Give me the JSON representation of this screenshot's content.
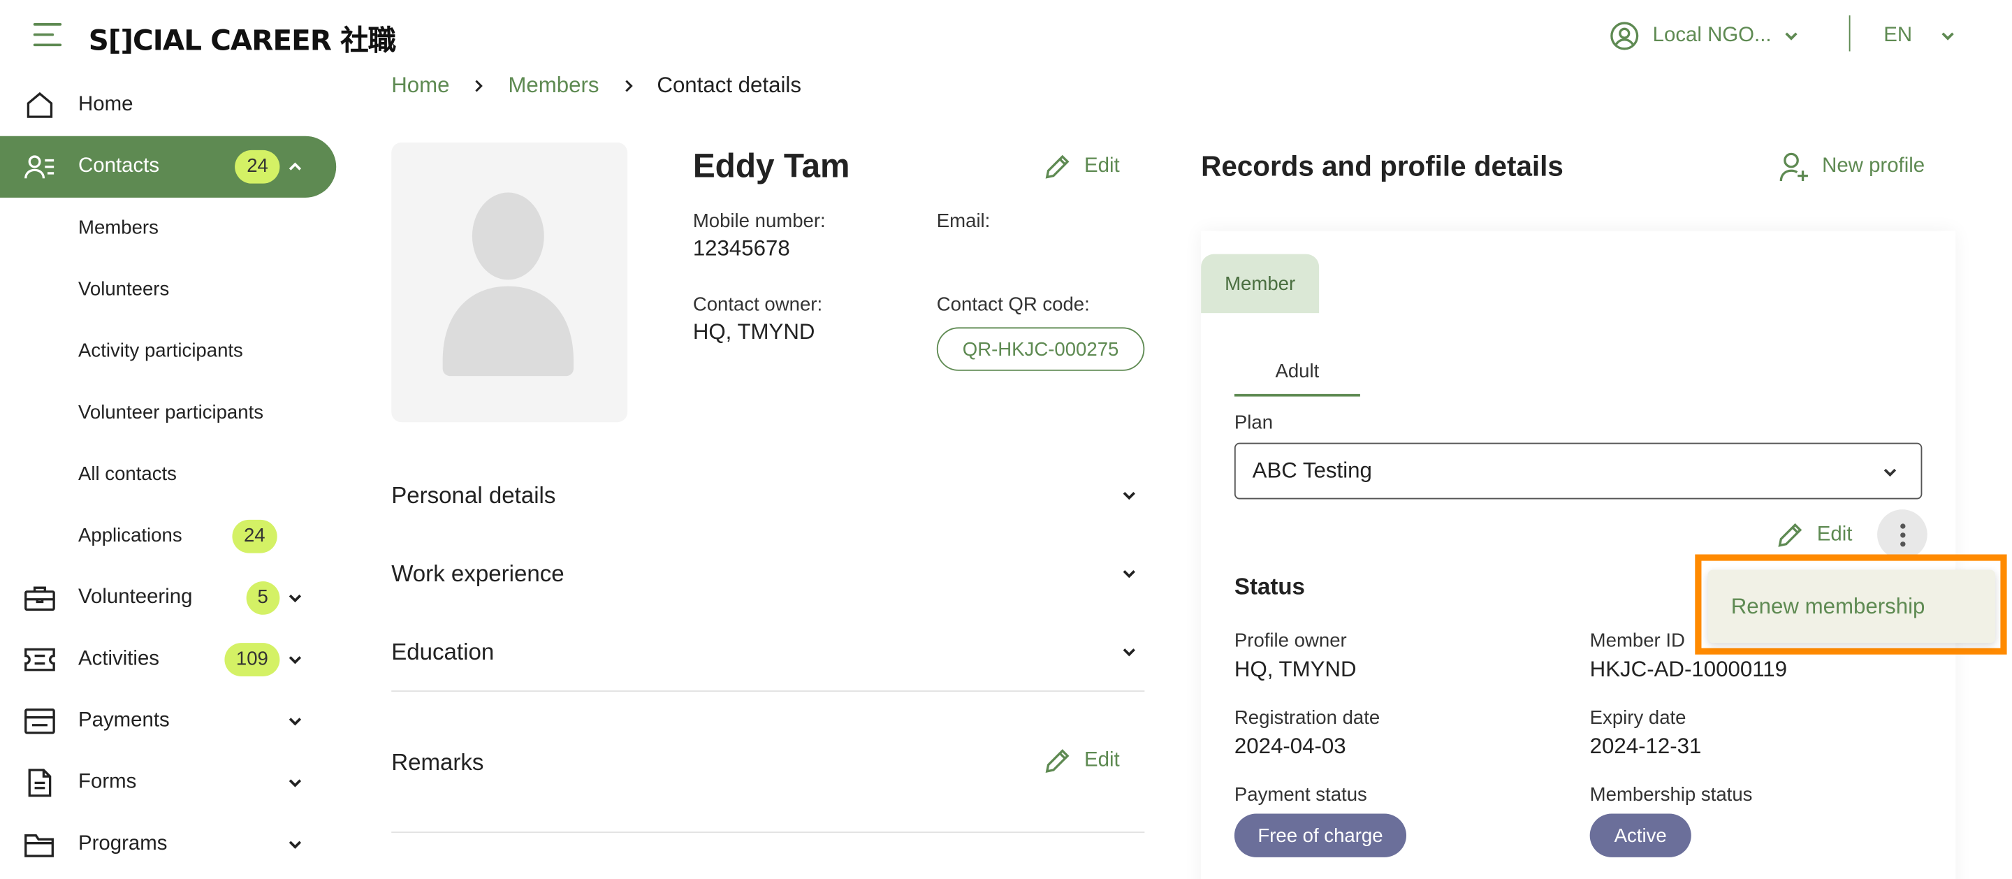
{
  "header": {
    "logo_text": "S[]CIAL CAREER 社職",
    "org_selector": "Local NGO...",
    "language": "EN"
  },
  "sidebar": {
    "home": "Home",
    "contacts": {
      "label": "Contacts",
      "badge": "24"
    },
    "sub_items": [
      "Members",
      "Volunteers",
      "Activity participants",
      "Volunteer participants",
      "All contacts",
      "Applications"
    ],
    "applications_badge": "24",
    "volunteering": {
      "label": "Volunteering",
      "badge": "5"
    },
    "activities": {
      "label": "Activities",
      "badge": "109"
    },
    "payments": "Payments",
    "forms": "Forms",
    "programs": "Programs"
  },
  "breadcrumb": {
    "home": "Home",
    "members": "Members",
    "current": "Contact details"
  },
  "contact": {
    "name": "Eddy Tam",
    "edit": "Edit",
    "mobile_label": "Mobile number:",
    "mobile_value": "12345678",
    "email_label": "Email:",
    "owner_label": "Contact owner:",
    "owner_value": "HQ, TMYND",
    "qr_label": "Contact QR code:",
    "qr_value": "QR-HKJC-000275"
  },
  "sections": {
    "personal": "Personal details",
    "work": "Work experience",
    "education": "Education",
    "remarks": "Remarks",
    "remarks_edit": "Edit"
  },
  "records": {
    "title": "Records and profile details",
    "new_profile": "New profile",
    "member_tab": "Member",
    "adult_tab": "Adult",
    "plan_label": "Plan",
    "plan_value": "ABC Testing",
    "edit": "Edit",
    "status_heading": "Status",
    "profile_owner_label": "Profile owner",
    "profile_owner_value": "HQ, TMYND",
    "member_id_label": "Member ID",
    "member_id_value": "HKJC-AD-10000119",
    "registration_label": "Registration date",
    "registration_value": "2024-04-03",
    "expiry_label": "Expiry date",
    "expiry_value": "2024-12-31",
    "payment_status_label": "Payment status",
    "payment_status_value": "Free of charge",
    "membership_status_label": "Membership status",
    "membership_status_value": "Active"
  },
  "menu": {
    "renew": "Renew membership"
  },
  "colors": {
    "primary_green": "#5e8a52",
    "badge_lime": "#d4f165",
    "pill_slate": "#6b6f9a",
    "highlight_orange": "#ff8a00"
  },
  "icons": [
    "menu-icon",
    "account-circle-icon",
    "home-icon",
    "contacts-icon",
    "briefcase-icon",
    "ticket-icon",
    "wallet-icon",
    "document-icon",
    "folder-icon",
    "pencil-icon",
    "user-plus-icon",
    "chevron-down-icon",
    "kebab-icon"
  ]
}
